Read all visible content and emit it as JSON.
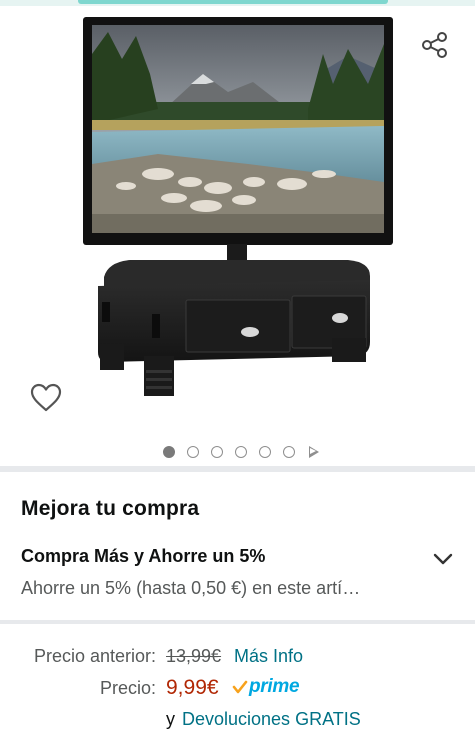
{
  "gallery": {
    "image_count": 6,
    "active_index": 0,
    "has_video": true
  },
  "improve": {
    "title": "Mejora tu compra"
  },
  "deal": {
    "title": "Compra Más y Ahorre un 5%",
    "description": "Ahorre un 5% (hasta 0,50 €) en este artí…"
  },
  "pricing": {
    "previous_label": "Precio anterior:",
    "previous_value": "13,99€",
    "more_info": "Más Info",
    "price_label": "Precio:",
    "price_value": "9,99€",
    "prime_label": "prime",
    "and_text": "y",
    "returns_text": "Devoluciones GRATIS"
  },
  "colors": {
    "accent_link": "#007185",
    "price": "#b12704",
    "prime": "#00a8e1"
  },
  "icons": [
    "share-icon",
    "heart-icon",
    "chevron-down-icon",
    "play-icon",
    "prime-check-icon"
  ]
}
